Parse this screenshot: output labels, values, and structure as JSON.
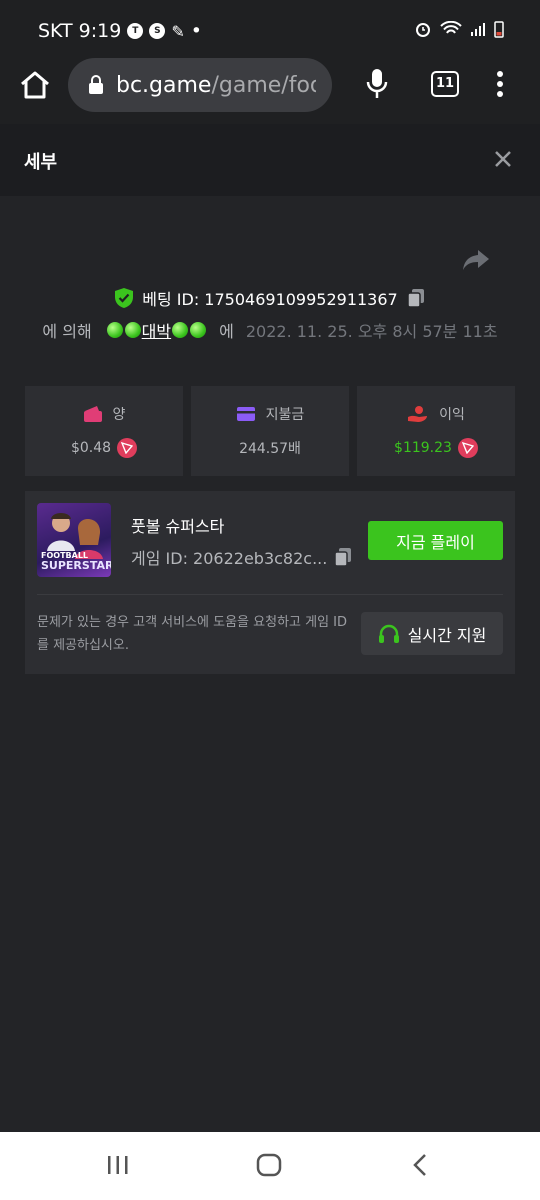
{
  "status_bar": {
    "carrier": "SKT",
    "time": "9:19",
    "dot": "•"
  },
  "browser": {
    "url_host": "bc.game",
    "url_path": "/game/foot",
    "tab_count": "11"
  },
  "header": {
    "title": "세부"
  },
  "bet": {
    "label": "베팅 ID: 1750469109952911367",
    "by_prefix": "에 의해",
    "user_name": "대박",
    "on_text": "에",
    "date": "2022. 11. 25. 오후 8시 57분 11초"
  },
  "stats": [
    {
      "label": "양",
      "value": "$0.48",
      "icon": "wallet-icon",
      "color": "#e03d76"
    },
    {
      "label": "지불금",
      "value": "244.57배",
      "icon": "card-icon",
      "color": "#8b5cf6"
    },
    {
      "label": "이익",
      "value": "$119.23",
      "icon": "hand-coin-icon",
      "color": "#e03d3d"
    }
  ],
  "game": {
    "name": "풋볼 슈퍼스타",
    "id_text": "게임 ID: 20622eb3c82c...",
    "play_label": "지금 플레이",
    "thumb_line1": "FOOTBALL",
    "thumb_line2": "SUPERSTAR",
    "help_text": "문제가 있는 경우 고객 서비스에 도움을 요청하고 게임 ID를 제공하십시오.",
    "support_label": "실시간 지원"
  },
  "colors": {
    "accent_green": "#3bc41e",
    "panel": "#2d2e32",
    "background": "#232427"
  }
}
